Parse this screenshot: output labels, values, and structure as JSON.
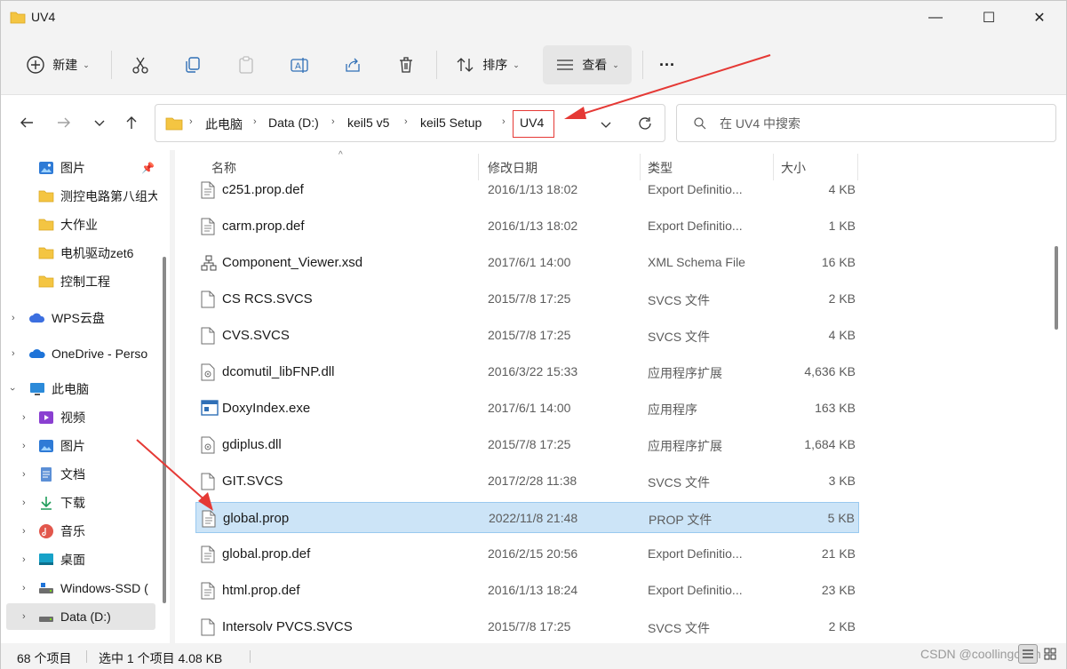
{
  "window": {
    "title": "UV4",
    "minimize_glyph": "—",
    "maximize_glyph": "☐",
    "close_glyph": "✕"
  },
  "toolbar": {
    "new_label": "新建",
    "sort_label": "排序",
    "view_label": "查看",
    "more_glyph": "···"
  },
  "breadcrumb": [
    "此电脑",
    "Data (D:)",
    "keil5 v5",
    "keil5  Setup",
    "UV4"
  ],
  "search": {
    "placeholder": "在 UV4 中搜索"
  },
  "nav": {
    "items": [
      {
        "label": "图片",
        "icon": "pictures-icon",
        "pinned": true
      },
      {
        "label": "测控电路第八组大",
        "icon": "folder-icon"
      },
      {
        "label": "大作业",
        "icon": "folder-icon"
      },
      {
        "label": "电机驱动zet6",
        "icon": "folder-icon"
      },
      {
        "label": "控制工程",
        "icon": "folder-icon"
      },
      {
        "label": "WPS云盘",
        "icon": "wps-cloud-icon"
      },
      {
        "label": "OneDrive - Perso",
        "icon": "onedrive-icon"
      },
      {
        "label": "此电脑",
        "icon": "this-pc-icon"
      },
      {
        "label": "视频",
        "icon": "videos-icon"
      },
      {
        "label": "图片",
        "icon": "pictures-icon"
      },
      {
        "label": "文档",
        "icon": "documents-icon"
      },
      {
        "label": "下载",
        "icon": "downloads-icon"
      },
      {
        "label": "音乐",
        "icon": "music-icon"
      },
      {
        "label": "桌面",
        "icon": "desktop-icon"
      },
      {
        "label": "Windows-SSD (",
        "icon": "drive-icon"
      },
      {
        "label": "Data (D:)",
        "icon": "drive-icon",
        "selected": true
      }
    ]
  },
  "columns": {
    "name": "名称",
    "date": "修改日期",
    "type": "类型",
    "size": "大小"
  },
  "files": [
    {
      "name": "c251.prop.def",
      "date": "2016/1/13 18:02",
      "type": "Export Definitio...",
      "size": "4 KB",
      "icon": "document-icon"
    },
    {
      "name": "carm.prop.def",
      "date": "2016/1/13 18:02",
      "type": "Export Definitio...",
      "size": "1 KB",
      "icon": "document-icon"
    },
    {
      "name": "Component_Viewer.xsd",
      "date": "2017/6/1 14:00",
      "type": "XML Schema File",
      "size": "16 KB",
      "icon": "schema-icon"
    },
    {
      "name": "CS RCS.SVCS",
      "date": "2015/7/8 17:25",
      "type": "SVCS 文件",
      "size": "2 KB",
      "icon": "blank-file-icon"
    },
    {
      "name": "CVS.SVCS",
      "date": "2015/7/8 17:25",
      "type": "SVCS 文件",
      "size": "4 KB",
      "icon": "blank-file-icon"
    },
    {
      "name": "dcomutil_libFNP.dll",
      "date": "2016/3/22 15:33",
      "type": "应用程序扩展",
      "size": "4,636 KB",
      "icon": "dll-icon"
    },
    {
      "name": "DoxyIndex.exe",
      "date": "2017/6/1 14:00",
      "type": "应用程序",
      "size": "163 KB",
      "icon": "exe-icon"
    },
    {
      "name": "gdiplus.dll",
      "date": "2015/7/8 17:25",
      "type": "应用程序扩展",
      "size": "1,684 KB",
      "icon": "dll-icon"
    },
    {
      "name": "GIT.SVCS",
      "date": "2017/2/28 11:38",
      "type": "SVCS 文件",
      "size": "3 KB",
      "icon": "blank-file-icon"
    },
    {
      "name": "global.prop",
      "date": "2022/11/8 21:48",
      "type": "PROP 文件",
      "size": "5 KB",
      "icon": "document-icon",
      "selected": true
    },
    {
      "name": "global.prop.def",
      "date": "2016/2/15 20:56",
      "type": "Export Definitio...",
      "size": "21 KB",
      "icon": "document-icon"
    },
    {
      "name": "html.prop.def",
      "date": "2016/1/13 18:24",
      "type": "Export Definitio...",
      "size": "23 KB",
      "icon": "document-icon"
    },
    {
      "name": "Intersolv PVCS.SVCS",
      "date": "2015/7/8 17:25",
      "type": "SVCS 文件",
      "size": "2 KB",
      "icon": "blank-file-icon"
    }
  ],
  "status": {
    "count": "68 个项目",
    "selection": "选中 1 个项目  4.08 KB"
  },
  "watermark": "CSDN @coollingchen",
  "colors": {
    "selected_row_bg": "#cce4f7",
    "selected_row_border": "#99c9ef",
    "highlight_red": "#e53935",
    "folder_yellow": "#f4c542"
  }
}
